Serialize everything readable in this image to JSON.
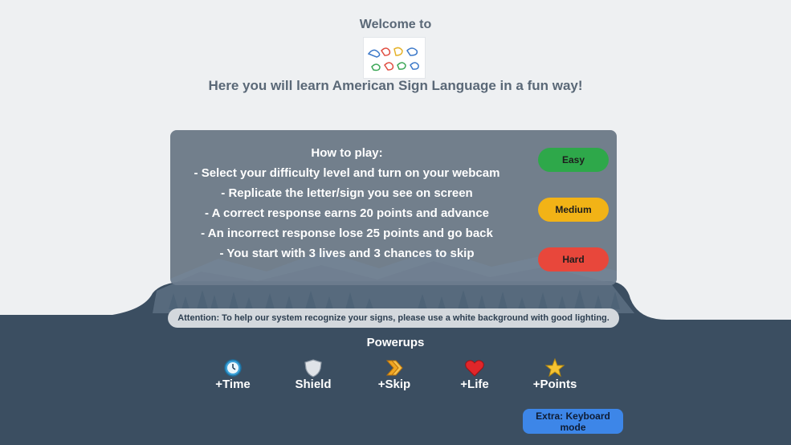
{
  "header": {
    "welcome": "Welcome to",
    "tagline": "Here you will learn American Sign Language in a fun way!"
  },
  "instructions": {
    "lines": [
      "How to play:",
      "- Select your difficulty level and turn on your webcam",
      "- Replicate the letter/sign you see on screen",
      "- A correct response earns 20 points and advance",
      "- An incorrect response lose 25 points and go back",
      "- You start with 3 lives and 3 chances to skip"
    ]
  },
  "difficulty": {
    "easy": "Easy",
    "medium": "Medium",
    "hard": "Hard"
  },
  "attention": "Attention: To help our system recognize your signs, please use a white background with good lighting.",
  "powerups": {
    "title": "Powerups",
    "items": [
      {
        "label": "+Time",
        "icon": "clock-icon"
      },
      {
        "label": "Shield",
        "icon": "shield-icon"
      },
      {
        "label": "+Skip",
        "icon": "skip-arrow-icon"
      },
      {
        "label": "+Life",
        "icon": "heart-icon"
      },
      {
        "label": "+Points",
        "icon": "star-icon"
      }
    ]
  },
  "keyboard_button": "Extra: Keyboard mode",
  "colors": {
    "easy": "#2ea84a",
    "medium": "#f2b316",
    "hard": "#e8473b",
    "keyboard": "#3d86e8",
    "dark_bg": "#3b4e61"
  }
}
